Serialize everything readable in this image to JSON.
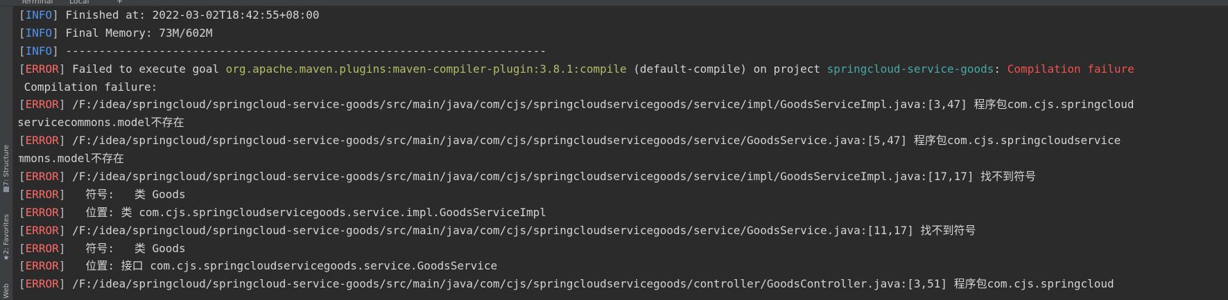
{
  "tabs": [
    "Terminal",
    "Local",
    "+"
  ],
  "sidebar": {
    "items": [
      {
        "label": "7: Structure",
        "icon": "structure-icon"
      },
      {
        "label": "2: Favorites",
        "icon": "star-icon"
      },
      {
        "label": "Web",
        "icon": "web-icon"
      }
    ]
  },
  "colors": {
    "background": "#2b2b2b",
    "info": "#5394ec",
    "error": "#ff6b68",
    "text": "#d4d4d4",
    "plugin": "#b5bd68",
    "project": "#4aa7a7",
    "failure": "#f0524f"
  },
  "console": {
    "lines": [
      {
        "level": "INFO",
        "text": " Finished at: 2022-03-02T18:42:55+08:00"
      },
      {
        "level": "INFO",
        "text": " Final Memory: 73M/602M"
      },
      {
        "level": "INFO",
        "text": " ------------------------------------------------------------------------"
      },
      {
        "level": "ERROR",
        "pre": " Failed to execute goal ",
        "plugin": "org.apache.maven.plugins:maven-compiler-plugin:3.8.1:compile",
        "mid": " (default-compile) on project ",
        "project": "springcloud-service-goods",
        "sep": ": ",
        "failure": "Compilation failure"
      },
      {
        "level": "",
        "text": " Compilation failure:"
      },
      {
        "level": "ERROR",
        "text": " /F:/idea/springcloud/springcloud-service-goods/src/main/java/com/cjs/springcloudservicegoods/service/impl/GoodsServiceImpl.java:[3,47] 程序包com.cjs.springcloud"
      },
      {
        "level": "",
        "text": "servicecommons.model不存在"
      },
      {
        "level": "ERROR",
        "text": " /F:/idea/springcloud/springcloud-service-goods/src/main/java/com/cjs/springcloudservicegoods/service/GoodsService.java:[5,47] 程序包com.cjs.springcloudservice"
      },
      {
        "level": "",
        "text": "mmons.model不存在"
      },
      {
        "level": "ERROR",
        "text": " /F:/idea/springcloud/springcloud-service-goods/src/main/java/com/cjs/springcloudservicegoods/service/impl/GoodsServiceImpl.java:[17,17] 找不到符号"
      },
      {
        "level": "ERROR",
        "text": "   符号:   类 Goods"
      },
      {
        "level": "ERROR",
        "text": "   位置: 类 com.cjs.springcloudservicegoods.service.impl.GoodsServiceImpl"
      },
      {
        "level": "ERROR",
        "text": " /F:/idea/springcloud/springcloud-service-goods/src/main/java/com/cjs/springcloudservicegoods/service/GoodsService.java:[11,17] 找不到符号"
      },
      {
        "level": "ERROR",
        "text": "   符号:   类 Goods"
      },
      {
        "level": "ERROR",
        "text": "   位置: 接口 com.cjs.springcloudservicegoods.service.GoodsService"
      },
      {
        "level": "ERROR",
        "text": " /F:/idea/springcloud/springcloud-service-goods/src/main/java/com/cjs/springcloudservicegoods/controller/GoodsController.java:[3,51] 程序包com.cjs.springcloud"
      }
    ]
  }
}
